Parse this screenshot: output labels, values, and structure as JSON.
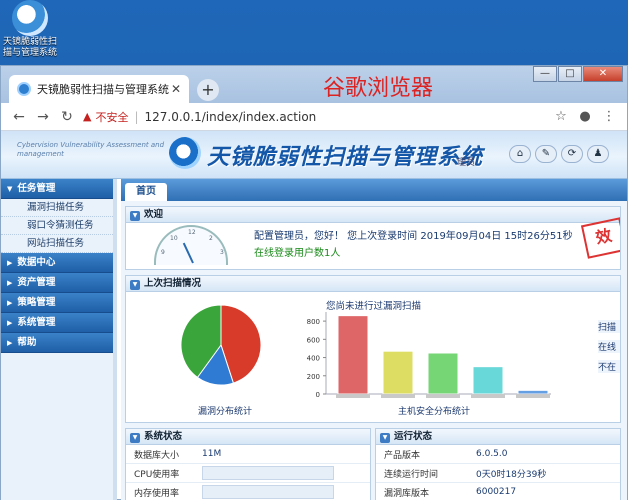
{
  "desktop": {
    "icon_label": "天镜脆弱性扫描与管理系统"
  },
  "browser": {
    "tab_title": "天镜脆弱性扫描与管理系统",
    "brand_text": "谷歌浏览器",
    "insecure_label": "不安全",
    "url": "127.0.0.1/index/index.action"
  },
  "banner": {
    "en_text": "Cybervision Vulnerability Assessment and management",
    "title": "天镜脆弱性扫描与管理系统",
    "admin_text": "理员！"
  },
  "sidebar": {
    "sections": [
      {
        "label": "任务管理",
        "items": [
          "漏洞扫描任务",
          "弱口令猜测任务",
          "网站扫描任务"
        ]
      },
      {
        "label": "数据中心"
      },
      {
        "label": "资产管理"
      },
      {
        "label": "策略管理"
      },
      {
        "label": "系统管理"
      },
      {
        "label": "帮助"
      }
    ]
  },
  "content": {
    "tab": "首页",
    "welcome": {
      "header": "欢迎",
      "line1": "配置管理员，您好！ 您上次登录时间 2019年09月04日 15时26分51秒",
      "line2": "在线登录用户数1人",
      "stamp": "效"
    },
    "last_scan": {
      "header": "上次扫描情况",
      "chart_title": "您尚未进行过漏洞扫描",
      "pie_label": "漏洞分布统计",
      "bar_label": "主机安全分布统计",
      "side_links": [
        "扫描",
        "在线",
        "不在"
      ]
    },
    "system_status": {
      "header": "系统状态",
      "rows": [
        {
          "k": "数据库大小",
          "v": "11M"
        },
        {
          "k": "CPU使用率",
          "v": ""
        },
        {
          "k": "内存使用率",
          "v": ""
        }
      ]
    },
    "run_status": {
      "header": "运行状态",
      "rows": [
        {
          "k": "产品版本",
          "v": "6.0.5.0"
        },
        {
          "k": "连续运行时间",
          "v": "0天0时18分39秒"
        },
        {
          "k": "漏洞库版本",
          "v": "6000217"
        }
      ]
    }
  },
  "chart_data": {
    "type": "bar",
    "categories": [
      "1",
      "2",
      "3",
      "4",
      "5"
    ],
    "values": [
      860,
      470,
      450,
      300,
      40
    ],
    "colors": [
      "#d94c4c",
      "#d8d84a",
      "#5fcf5f",
      "#4fd2d2",
      "#4a8fe0"
    ],
    "ylim": [
      0,
      900
    ],
    "yticks": [
      "800",
      "600",
      "400",
      "200",
      "0"
    ]
  },
  "pie_data": [
    {
      "value": 45,
      "color": "#d93b2b"
    },
    {
      "value": 15,
      "color": "#2f7ad3"
    },
    {
      "value": 40,
      "color": "#3aa53a"
    }
  ]
}
